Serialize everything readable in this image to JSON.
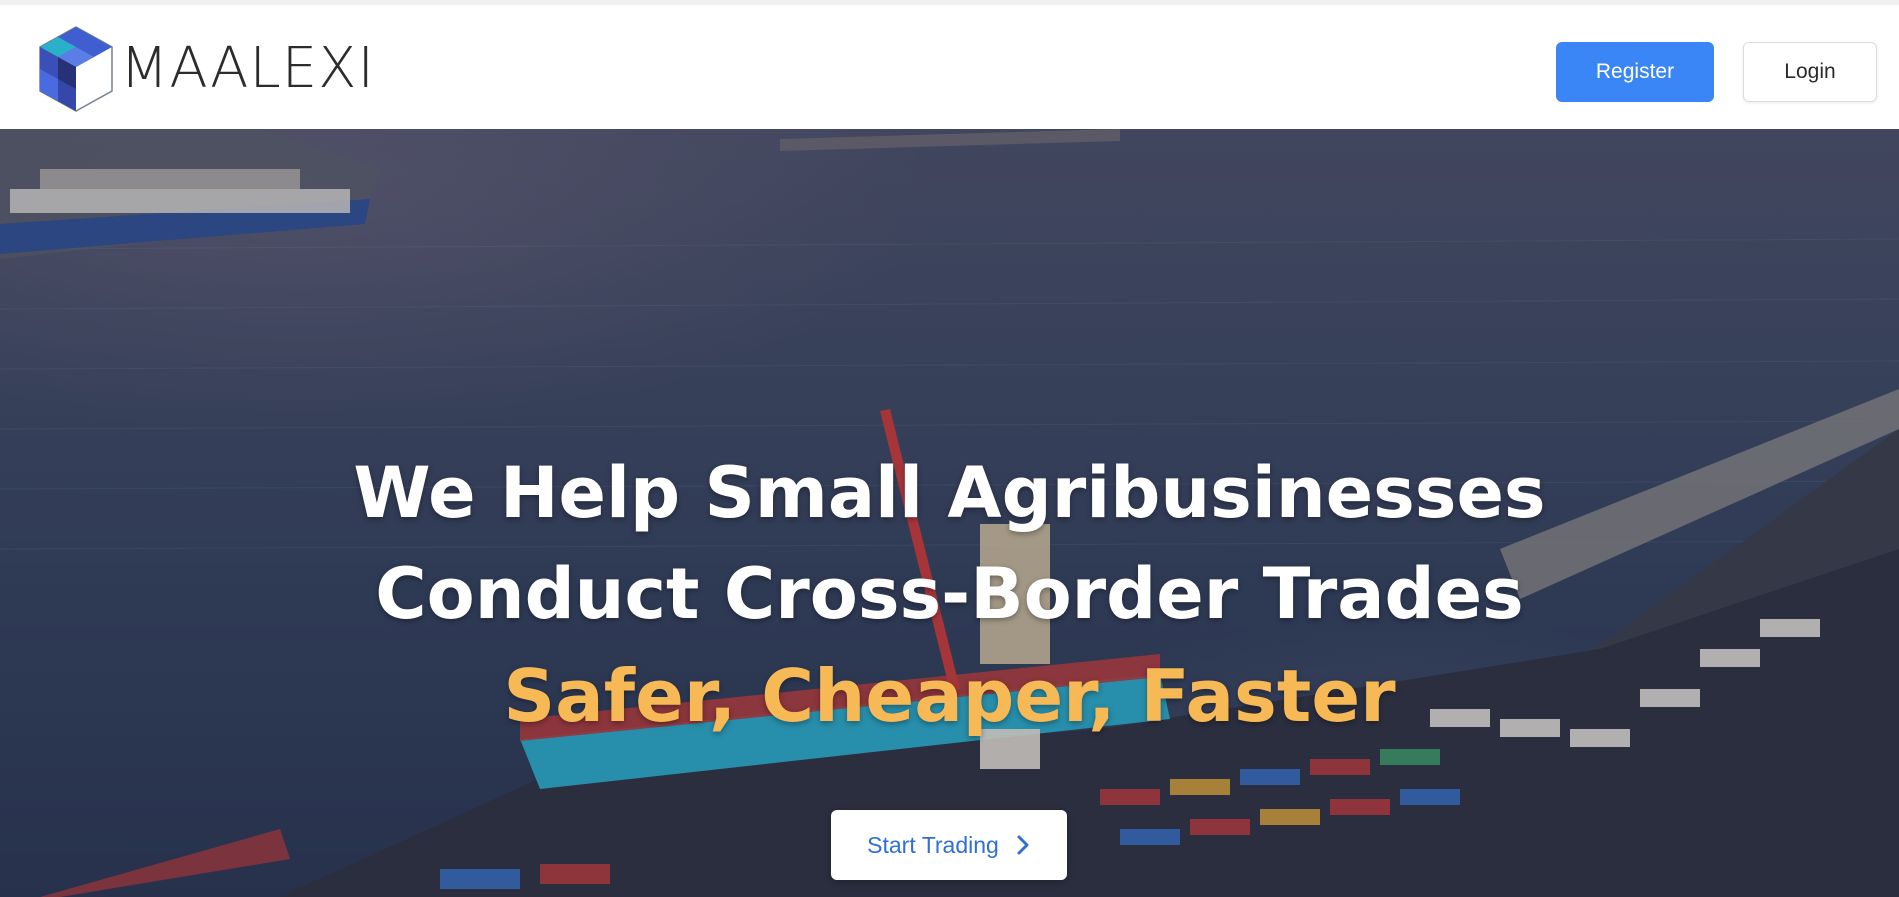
{
  "header": {
    "logo_text": "MAALEXI",
    "register_label": "Register",
    "login_label": "Login"
  },
  "hero": {
    "line1": "We Help Small Agribusinesses",
    "line2": "Conduct Cross-Border Trades",
    "line3": "Safer, Cheaper, Faster",
    "cta_label": "Start Trading",
    "cta_icon": "chevron-right-icon",
    "background": "aerial-port-photo"
  },
  "colors": {
    "brand_blue": "#3b86f7",
    "cta_text": "#2f6fd6",
    "accent_orange": "#f7b955",
    "logo_dark_blue": "#2e3a8c",
    "logo_mid_blue": "#3f5fd0",
    "logo_teal": "#2ab1c9"
  }
}
